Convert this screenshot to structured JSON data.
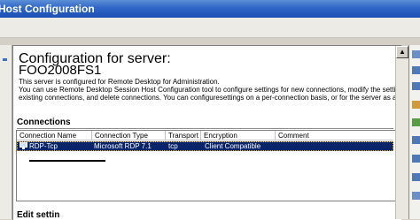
{
  "window": {
    "title": "Host Configuration"
  },
  "main": {
    "heading": "Configuration for server:",
    "server_name": "FOO2008FS1",
    "description_lines": [
      "This server is configured for Remote Desktop for Administration.",
      "You can use Remote Desktop Session Host Configuration tool to configure settings for new connections, modify the settings of",
      "existing connections, and delete connections. You can configuresettings on a per-connection basis, or for the server as a whole."
    ]
  },
  "connections": {
    "heading": "Connections",
    "columns": [
      "Connection Name",
      "Connection Type",
      "Transport",
      "Encryption",
      "Comment"
    ],
    "rows": [
      {
        "name": "RDP-Tcp",
        "type": "Microsoft RDP 7.1",
        "transport": "tcp",
        "encryption": "Client Compatible",
        "comment": "",
        "selected": true
      }
    ]
  },
  "edit_settings": {
    "heading_partial": "Edit settin"
  },
  "icons": [
    "rdp-connection-icon",
    "scroll-up-arrow-icon"
  ],
  "colors": {
    "title_bar": "#2f66c7",
    "selection": "#0a246a",
    "panel": "#d4d0c8",
    "content": "#ffffff"
  }
}
